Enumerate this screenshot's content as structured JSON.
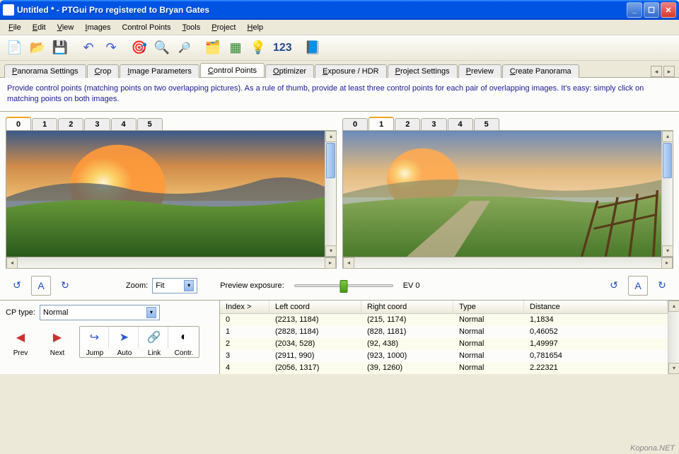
{
  "window": {
    "title": "Untitled * - PTGui Pro registered to Bryan Gates"
  },
  "menu": {
    "items": [
      "File",
      "Edit",
      "View",
      "Images",
      "Control Points",
      "Tools",
      "Project",
      "Help"
    ],
    "underline_indices": [
      0,
      0,
      0,
      0,
      null,
      0,
      0,
      0
    ]
  },
  "toolbar": {
    "num_label": "123"
  },
  "main_tabs": {
    "items": [
      "Panorama Settings",
      "Crop",
      "Image Parameters",
      "Control Points",
      "Optimizer",
      "Exposure / HDR",
      "Project Settings",
      "Preview",
      "Create Panorama"
    ],
    "active_index": 3
  },
  "hint_text": "Provide control points (matching points on two overlapping pictures). As a rule of thumb, provide at least three control points for each pair of overlapping images. It's easy: simply click on matching points on both images.",
  "left_image": {
    "tabs": [
      "0",
      "1",
      "2",
      "3",
      "4",
      "5"
    ],
    "active_index": 0
  },
  "right_image": {
    "tabs": [
      "0",
      "1",
      "2",
      "3",
      "4",
      "5"
    ],
    "active_index": 1
  },
  "mid": {
    "zoom_label": "Zoom:",
    "zoom_value": "Fit",
    "preview_exposure_label": "Preview exposure:",
    "ev_label": "EV 0",
    "auto_a": "A"
  },
  "bottom_left": {
    "cp_type_label": "CP type:",
    "cp_type_value": "Normal",
    "prev_label": "Prev",
    "next_label": "Next",
    "jump_label": "Jump",
    "auto_label": "Auto",
    "link_label": "Link",
    "contr_label": "Contr."
  },
  "table": {
    "headers": [
      "Index >",
      "Left coord",
      "Right coord",
      "Type",
      "Distance"
    ],
    "rows": [
      {
        "index": "0",
        "left": "(2213, 1184)",
        "right": "(215, 1174)",
        "type": "Normal",
        "distance": "1,1834"
      },
      {
        "index": "1",
        "left": "(2828, 1184)",
        "right": "(828, 1181)",
        "type": "Normal",
        "distance": "0,46052"
      },
      {
        "index": "2",
        "left": "(2034, 528)",
        "right": "(92, 438)",
        "type": "Normal",
        "distance": "1,49997"
      },
      {
        "index": "3",
        "left": "(2911, 990)",
        "right": "(923, 1000)",
        "type": "Normal",
        "distance": "0,781654"
      },
      {
        "index": "4",
        "left": "(2056, 1317)",
        "right": "(39, 1260)",
        "type": "Normal",
        "distance": "2.22321"
      }
    ]
  },
  "watermark": "Kopona.NET"
}
